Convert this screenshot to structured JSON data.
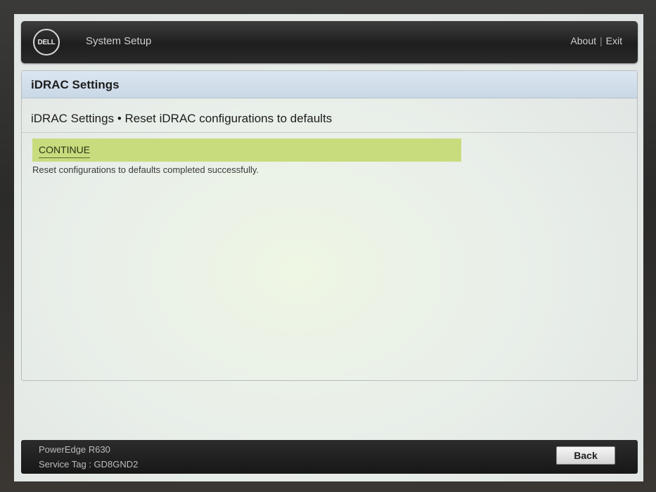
{
  "header": {
    "logo_text": "DELL",
    "title": "System Setup",
    "about_label": "About",
    "separator": "|",
    "exit_label": "Exit"
  },
  "panel": {
    "title": "iDRAC Settings",
    "breadcrumb": "iDRAC Settings • Reset iDRAC configurations to defaults",
    "continue_label": "CONTINUE",
    "status_message": "Reset configurations to defaults completed successfully."
  },
  "footer": {
    "model": "PowerEdge R630",
    "service_tag": "Service Tag : GD8GND2",
    "back_label": "Back"
  },
  "colors": {
    "highlight_row": "#c8dc7e",
    "header_band": "#c9d8e6",
    "bar_dark": "#1e1e1e"
  }
}
